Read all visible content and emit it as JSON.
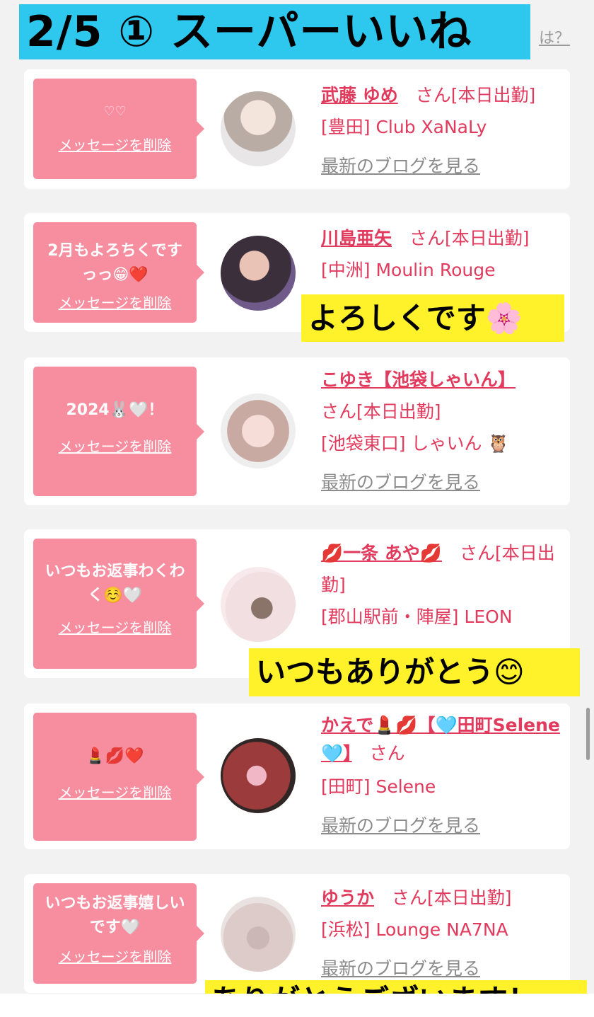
{
  "header": {
    "title": "2/5 ① スーパーいいね",
    "hint_text": "は？"
  },
  "delete_label": "メッセージを削除",
  "blog_label": "最新のブログを見る",
  "cards": [
    {
      "message": "♡♡",
      "name": "武藤 ゆめ",
      "suffix": "さん[本日出勤]",
      "store": "[豊田] Club XaNaLy"
    },
    {
      "message": "2月もよろちくですっっ😁❤️",
      "name": "川島亜矢",
      "suffix": "さん[本日出勤]",
      "store": "[中洲] Moulin Rouge"
    },
    {
      "message": "2024🐰🤍！",
      "name": "こゆき【池袋しゃいん】",
      "suffix": "さん[本日出勤]",
      "store": "[池袋東口] しゃいん 🦉"
    },
    {
      "message": "いつもお返事わくわく☺️🤍",
      "name": "💋一条 あや💋",
      "suffix": "さん[本日出勤]",
      "store": "[郡山駅前・陣屋] LEON"
    },
    {
      "message": "💄💋❤️",
      "name": "かえで💄💋【🩵田町Selene🩵】",
      "suffix": "さん",
      "store": "[田町] Selene"
    },
    {
      "message": "いつもお返事嬉しいです🤍",
      "name": "ゆうか",
      "suffix": "さん[本日出勤]",
      "store": "[浜松] Lounge NA7NA"
    }
  ],
  "stickers": {
    "s1": "よろしくです🌸",
    "s2": "いつもありがとう😊",
    "s3": "ありがとうございます！"
  },
  "colors": {
    "accent_pink": "#f78ea0",
    "name_red": "#e23a5c",
    "banner_blue": "#2ec8ee",
    "sticker_yellow": "#fff22a"
  }
}
